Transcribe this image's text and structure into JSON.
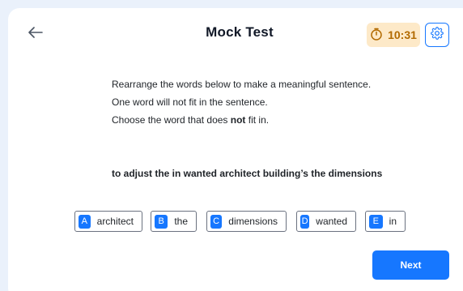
{
  "header": {
    "title": "Mock Test",
    "timer": "10:31",
    "back_icon": "arrow-left-icon",
    "timer_icon": "stopwatch-icon",
    "settings_icon": "gear-icon"
  },
  "instructions": {
    "line1": "Rearrange the words below to make a meaningful sentence.",
    "line2": "One word will not fit in the sentence.",
    "line3_prefix": "Choose the word that does ",
    "line3_bold": "not",
    "line3_suffix": " fit in."
  },
  "question": {
    "scrambled_sentence": "to adjust the in wanted architect building’s the dimensions"
  },
  "options": [
    {
      "letter": "A",
      "word": "architect"
    },
    {
      "letter": "B",
      "word": "the"
    },
    {
      "letter": "C",
      "word": "dimensions"
    },
    {
      "letter": "D",
      "word": "wanted"
    },
    {
      "letter": "E",
      "word": "in"
    }
  ],
  "footer": {
    "next_label": "Next"
  },
  "colors": {
    "accent": "#1677ff",
    "timer_bg": "#fde9c8",
    "timer_text": "#b26a00",
    "page_bg": "#eaf1fb"
  }
}
